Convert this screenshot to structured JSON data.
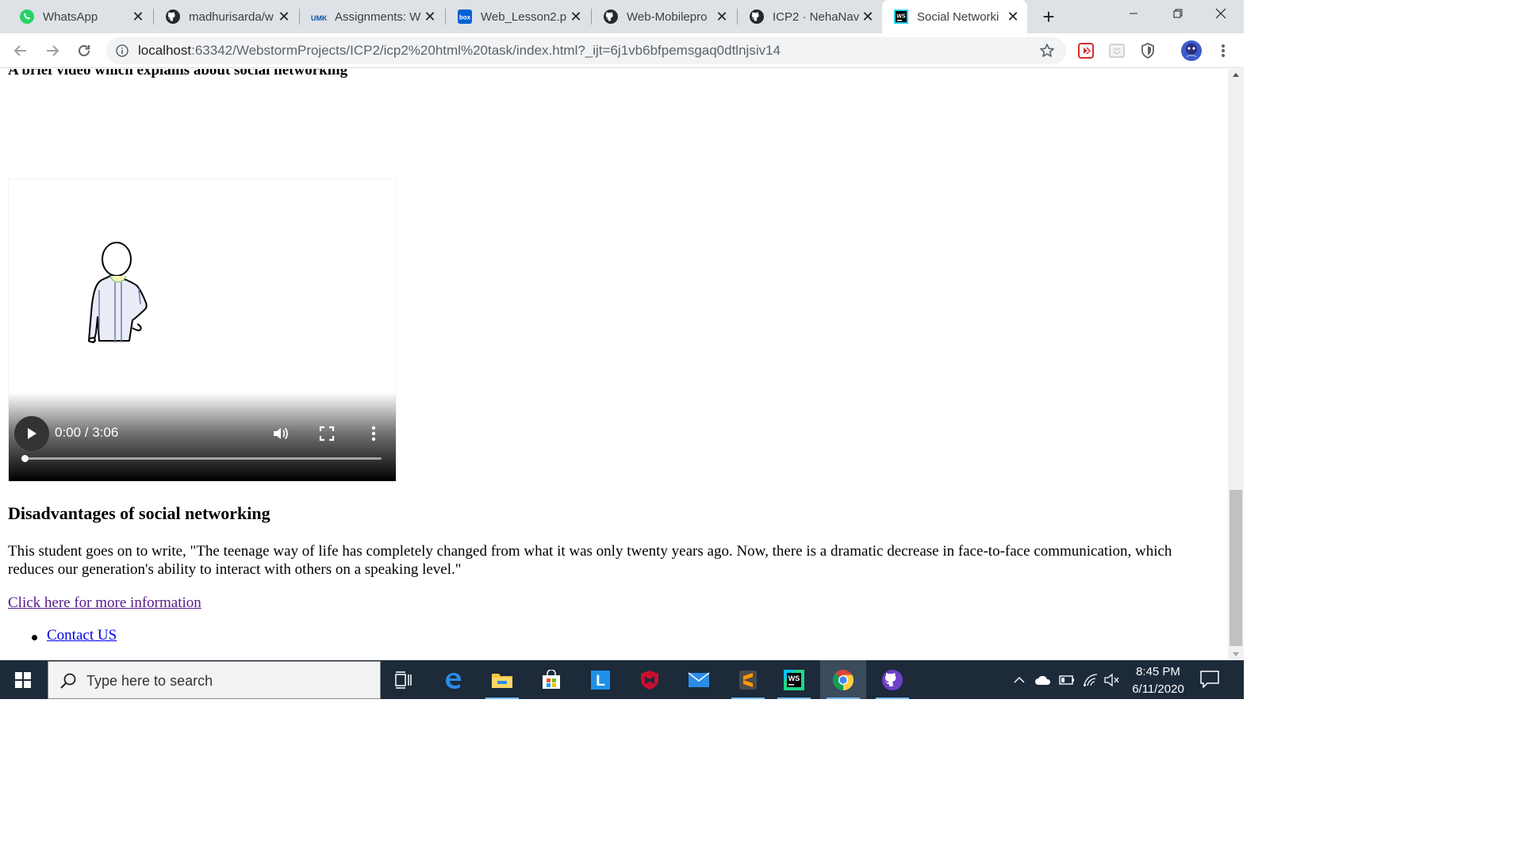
{
  "browser": {
    "tabs": [
      {
        "title": "WhatsApp",
        "icon": "whatsapp-icon"
      },
      {
        "title": "madhurisarda/w",
        "icon": "github-icon"
      },
      {
        "title": "Assignments: W",
        "icon": "umkc-icon"
      },
      {
        "title": "Web_Lesson2.p",
        "icon": "box-icon"
      },
      {
        "title": "Web-Mobilepro",
        "icon": "github-icon"
      },
      {
        "title": "ICP2 · NehaNav",
        "icon": "github-icon"
      },
      {
        "title": "Social Networki",
        "icon": "webstorm-icon"
      }
    ],
    "active_tab_index": 6,
    "url_host": "localhost",
    "url_path": ":63342/WebstormProjects/ICP2/icp2%20html%20task/index.html?_ijt=6j1vb6bfpemsgaq0dtlnjsiv14",
    "box_label": "box",
    "umkc_label": "UMKC",
    "ws_label": "WS"
  },
  "page": {
    "cut_heading": "A brief video which explains about social networking",
    "video": {
      "time": "0:00 / 3:06",
      "progress": 0
    },
    "disadvantages_heading": "Disadvantages of social networking",
    "disadvantages_text": "This student goes on to write, \"The teenage way of life has completely changed from what it was only twenty years ago. Now, there is a dramatic decrease in face-to-face communication, which reduces our generation's ability to interact with others on a speaking level.\"",
    "more_info_link": "Click here for more information",
    "list_items": [
      "Contact US"
    ]
  },
  "taskbar": {
    "search_placeholder": "Type here to search",
    "time": "8:45 PM",
    "date": "6/11/2020",
    "l_label": "L",
    "ws_label": "WS"
  },
  "colors": {
    "tabstrip": "#dee1e6",
    "visited_link": "#551a8b",
    "link": "#0000ee",
    "taskbar": "#1c2a3a"
  }
}
